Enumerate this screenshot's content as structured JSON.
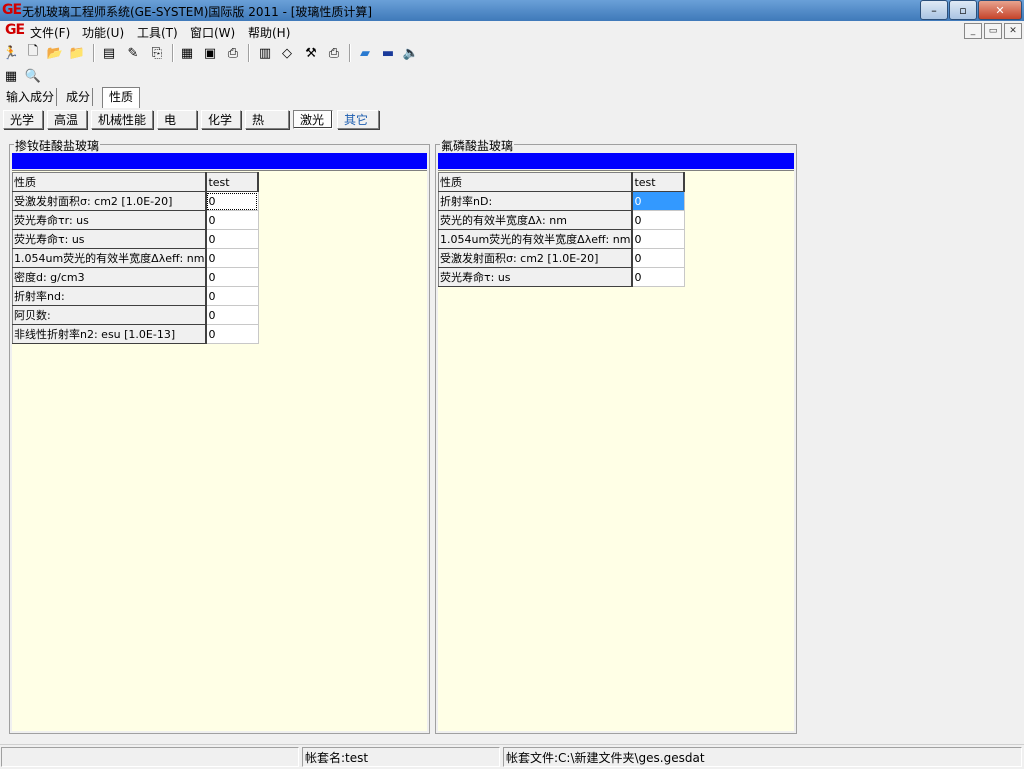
{
  "window": {
    "logo": "GE",
    "title": "无机玻璃工程师系统(GE-SYSTEM)国际版 2011 - [玻璃性质计算]",
    "controls": {
      "minimize": "–",
      "maximize": "▫",
      "close": "✕"
    }
  },
  "menu": {
    "logo": "GE",
    "items": [
      "文件(F)",
      "功能(U)",
      "工具(T)",
      "窗口(W)",
      "帮助(H)"
    ],
    "mdi_controls": {
      "minimize": "_",
      "restore": "▭",
      "close": "✕"
    }
  },
  "toolbar1_icons": [
    "run-icon",
    "new-file-icon",
    "open-folder-icon",
    "folder-icon",
    "preview-icon",
    "edit-icon",
    "export-icon",
    "table-icon",
    "form-icon",
    "print-icon",
    "calculator-icon",
    "eraser-icon",
    "tool-icon",
    "printer-icon",
    "book-icon",
    "ruler-icon",
    "speaker-icon"
  ],
  "toolbar2_icons": [
    "table-icon",
    "zoom-icon"
  ],
  "tabs": [
    "输入成分",
    "成分",
    "性质"
  ],
  "active_tab": "性质",
  "subtabs": [
    "光学",
    "高温",
    "机械性能",
    "电",
    "化学",
    "热",
    "激光",
    "其它"
  ],
  "pressed_subtab": "激光",
  "left_group": {
    "title": "掺钕硅酸盐玻璃",
    "header": {
      "name": "性质",
      "value": "test"
    },
    "rows": [
      {
        "name": "受激发射面积σ: cm2 [1.0E-20]",
        "value": "0"
      },
      {
        "name": "荧光寿命τr: us",
        "value": "0"
      },
      {
        "name": "荧光寿命τ: us",
        "value": "0"
      },
      {
        "name": "1.054um荧光的有效半宽度Δλeff: nm",
        "value": "0"
      },
      {
        "name": "密度d: g/cm3",
        "value": "0"
      },
      {
        "name": "折射率nd:",
        "value": "0"
      },
      {
        "name": "阿贝数:",
        "value": "0"
      },
      {
        "name": "非线性折射率n2: esu [1.0E-13]",
        "value": "0"
      }
    ]
  },
  "right_group": {
    "title": "氟磷酸盐玻璃",
    "header": {
      "name": "性质",
      "value": "test"
    },
    "rows": [
      {
        "name": "折射率nD:",
        "value": "0"
      },
      {
        "name": "荧光的有效半宽度Δλ: nm",
        "value": "0"
      },
      {
        "name": "1.054um荧光的有效半宽度Δλeff: nm",
        "value": "0"
      },
      {
        "name": "受激发射面积σ: cm2 [1.0E-20]",
        "value": "0"
      },
      {
        "name": "荧光寿命τ: us",
        "value": "0"
      }
    ]
  },
  "status": {
    "panel1": "",
    "account": "帐套名:test",
    "file": "帐套文件:C:\\新建文件夹\\ges.gesdat"
  },
  "colors": {
    "title_bar": "#4a86c8",
    "group_bar": "#0000ff",
    "grid_bg": "#ffffe6",
    "selection": "#3399ff"
  }
}
